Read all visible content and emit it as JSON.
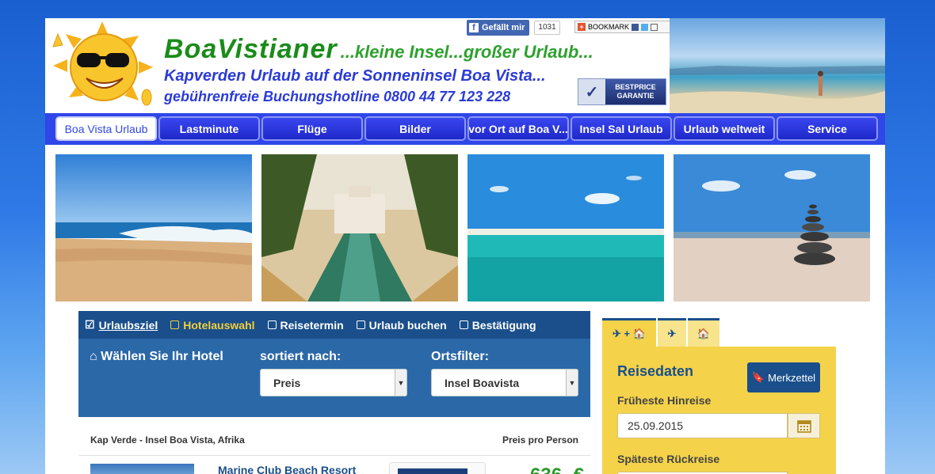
{
  "header": {
    "brand_name": "BoaVistianer",
    "brand_tagline": "...kleine Insel...großer Urlaub...",
    "subline": "Kapverden Urlaub auf der Sonneninsel Boa Vista...",
    "hotline": "gebührenfreie Buchungshotline 0800 44 77 123 228",
    "facebook_label": "Gefällt mir",
    "facebook_count": "1031",
    "bookmark_label": "BOOKMARK",
    "bestprice_line1": "BESTPRICE",
    "bestprice_line2": "GARANTIE"
  },
  "nav": {
    "items": [
      {
        "label": "Boa Vista Urlaub",
        "active": true
      },
      {
        "label": "Lastminute"
      },
      {
        "label": "Flüge"
      },
      {
        "label": "Bilder"
      },
      {
        "label": "vor Ort auf Boa V..."
      },
      {
        "label": "Insel Sal Urlaub"
      },
      {
        "label": "Urlaub weltweit"
      },
      {
        "label": "Service"
      }
    ]
  },
  "steps": [
    {
      "label": "Urlaubsziel",
      "state": "done"
    },
    {
      "label": "Hotelauswahl",
      "state": "current"
    },
    {
      "label": "Reisetermin",
      "state": "open"
    },
    {
      "label": "Urlaub buchen",
      "state": "open"
    },
    {
      "label": "Bestätigung",
      "state": "open"
    }
  ],
  "filter": {
    "hotel_label": "Wählen Sie Ihr Hotel",
    "sort_label": "sortiert nach:",
    "sort_value": "Preis",
    "location_label": "Ortsfilter:",
    "location_value": "Insel Boavista"
  },
  "results": {
    "region": "Kap Verde - Insel Boa Vista, Afrika",
    "price_label": "Preis pro Person",
    "first_hotel": "Marine Club Beach Resort",
    "first_price": "636,-€"
  },
  "widget": {
    "tabs": [
      {
        "label": "✈ + 🏠"
      },
      {
        "label": "✈"
      },
      {
        "label": "🏠"
      }
    ],
    "title": "Reisedaten",
    "merkzettel": "Merkzettel",
    "earliest_label": "Früheste Hinreise",
    "earliest_value": "25.09.2015",
    "latest_label": "Späteste Rückreise"
  },
  "colors": {
    "nav_blue": "#2f46e8",
    "panel_dark": "#1a4f8b",
    "panel_mid": "#2b68a8",
    "widget_yellow": "#f4d24a",
    "brand_green": "#1a8c1a",
    "brand_blue": "#2b3bd6"
  }
}
